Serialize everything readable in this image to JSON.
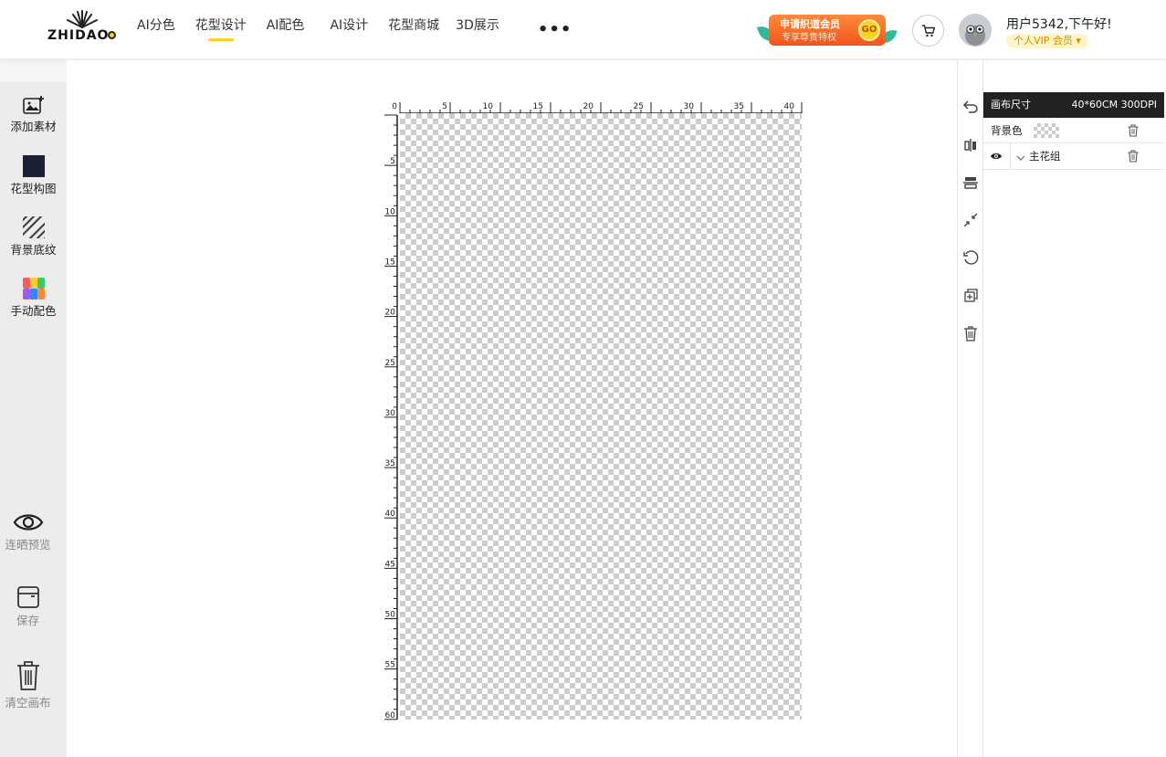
{
  "logo": {
    "text": "ZHIDAO"
  },
  "nav": {
    "items": [
      {
        "label": "AI分色",
        "active": false
      },
      {
        "label": "花型设计",
        "active": true
      },
      {
        "label": "AI配色",
        "active": false
      },
      {
        "label": "AI设计",
        "active": false
      },
      {
        "label": "花型商城",
        "active": false
      },
      {
        "label": "3D展示",
        "active": false
      }
    ],
    "more_label": "•••"
  },
  "vip_banner": {
    "title": "申请织道会员",
    "subtitle": "专享尊贵特权",
    "go": "GO"
  },
  "user": {
    "greeting": "用户5342,下午好!",
    "tag": "个人VIP 会员 ▾"
  },
  "left_tools": {
    "add_material": "添加素材",
    "pattern_layout": "花型构图",
    "bg_texture": "背景底纹",
    "manual_color": "手动配色",
    "repeat_preview": "连晒预览",
    "save": "保存",
    "clear_canvas": "清空画布"
  },
  "ruler": {
    "top_labels": [
      "0",
      "5",
      "10",
      "15",
      "20",
      "25",
      "30",
      "35",
      "40"
    ],
    "left_labels": [
      "5",
      "10",
      "15",
      "20",
      "25",
      "30",
      "35",
      "40",
      "45",
      "50",
      "55",
      "60"
    ]
  },
  "right_tools": [
    "undo-icon",
    "mirror-icon",
    "align-icon",
    "shrink-icon",
    "rotate-icon",
    "duplicate-icon",
    "delete-icon"
  ],
  "panel": {
    "canvas_size_label": "画布尺寸",
    "canvas_size_value": "40*60CM 300DPI",
    "bg_color_label": "背景色",
    "layer_name": "主花组"
  },
  "colors": {
    "accent": "#ffd21f",
    "vip_orange": "#f2541c",
    "panel_dark": "#222222"
  }
}
